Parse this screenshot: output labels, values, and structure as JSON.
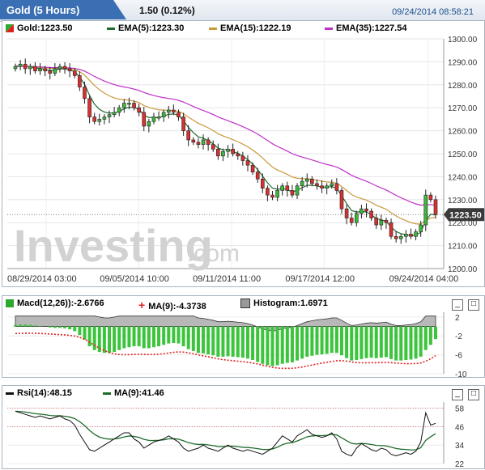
{
  "header": {
    "instrument_tab": "Gold (5 Hours)",
    "change": "1.50 (0.12%)",
    "datetime": "09/24/2014 08:58:21"
  },
  "price_panel": {
    "legend": [
      {
        "label": "Gold:1223.50",
        "color": "#ffffff"
      },
      {
        "label": "EMA(5):1223.30",
        "color": "#1f6b2c"
      },
      {
        "label": "EMA(15):1222.19",
        "color": "#c99a3a"
      },
      {
        "label": "EMA(35):1227.54",
        "color": "#c030c8"
      }
    ],
    "last_price_label": "1223.50",
    "watermark_main": "Investing",
    "watermark_suffix": ".com",
    "x_tick_labels": [
      "08/29/2014 03:00",
      "09/05/2014 10:00",
      "09/11/2014 11:00",
      "09/17/2014 12:00",
      "09/24/2014 04:00"
    ],
    "y_tick_labels": [
      "1300.00",
      "1290.00",
      "1280.00",
      "1270.00",
      "1260.00",
      "1250.00",
      "1240.00",
      "1230.00",
      "1220.00",
      "1210.00",
      "1200.00"
    ]
  },
  "macd_panel": {
    "legend": [
      {
        "label": "Macd(12,26)):-2.6766",
        "color": "#2ea82e"
      },
      {
        "label": "MA(9):-4.3738",
        "color": "#e02020"
      },
      {
        "label": "Histogram:1.6971",
        "color": "#9a9a9a"
      }
    ],
    "y_tick_labels": [
      "2",
      "-2",
      "-6",
      "-10"
    ],
    "minimize_icon": "minimize-icon",
    "maximize_icon": "maximize-icon"
  },
  "rsi_panel": {
    "legend": [
      {
        "label": "Rsi(14):48.15",
        "color": "#111111"
      },
      {
        "label": "MA(9):41.46",
        "color": "#1f6b2c"
      }
    ],
    "y_tick_labels": [
      "58",
      "46",
      "34",
      "22"
    ],
    "minimize_icon": "minimize-icon",
    "maximize_icon": "maximize-icon"
  },
  "chart_data": [
    {
      "type": "candlestick",
      "title": "Gold (5 Hours)",
      "ylim": [
        1200,
        1300
      ],
      "x_ticks": [
        "08/29/2014 03:00",
        "09/05/2014 10:00",
        "09/11/2014 11:00",
        "09/17/2014 12:00",
        "09/24/2014 04:00"
      ],
      "close": [
        1288,
        1289,
        1287,
        1288,
        1286,
        1287,
        1286,
        1285,
        1287,
        1288,
        1287,
        1286,
        1284,
        1279,
        1274,
        1266,
        1264,
        1265,
        1266,
        1267,
        1268,
        1270,
        1272,
        1272,
        1270,
        1268,
        1262,
        1264,
        1266,
        1266,
        1268,
        1269,
        1268,
        1266,
        1260,
        1256,
        1255,
        1254,
        1256,
        1254,
        1252,
        1249,
        1251,
        1252,
        1250,
        1249,
        1247,
        1245,
        1242,
        1239,
        1235,
        1232,
        1231,
        1234,
        1236,
        1234,
        1232,
        1236,
        1238,
        1239,
        1237,
        1236,
        1235,
        1236,
        1237,
        1234,
        1226,
        1222,
        1220,
        1224,
        1226,
        1225,
        1222,
        1219,
        1221,
        1220,
        1214,
        1213,
        1214,
        1215,
        1214,
        1216,
        1219,
        1232,
        1230,
        1223.5
      ],
      "series": [
        {
          "name": "EMA(5)",
          "last": 1223.3,
          "color": "#1f6b2c"
        },
        {
          "name": "EMA(15)",
          "last": 1222.19,
          "color": "#c99a3a"
        },
        {
          "name": "EMA(35)",
          "last": 1227.54,
          "color": "#c030c8"
        }
      ],
      "last_price": 1223.5
    },
    {
      "type": "bar",
      "title": "Macd(12,26)",
      "ylim": [
        -10,
        3
      ],
      "macd": [
        0.3,
        0.4,
        0.4,
        0.3,
        0.2,
        0.1,
        0.0,
        -0.2,
        -0.3,
        -0.3,
        -0.4,
        -0.6,
        -1.0,
        -1.8,
        -2.8,
        -4.2,
        -5.0,
        -5.4,
        -5.6,
        -5.6,
        -5.4,
        -5.0,
        -4.6,
        -4.4,
        -4.2,
        -4.2,
        -4.6,
        -4.6,
        -4.4,
        -4.2,
        -3.9,
        -3.6,
        -3.5,
        -3.6,
        -4.2,
        -4.8,
        -5.2,
        -5.6,
        -5.7,
        -5.9,
        -6.1,
        -6.4,
        -6.4,
        -6.3,
        -6.4,
        -6.5,
        -6.6,
        -6.8,
        -7.1,
        -7.5,
        -7.9,
        -8.2,
        -8.4,
        -8.2,
        -7.9,
        -7.7,
        -7.6,
        -7.2,
        -6.8,
        -6.4,
        -6.2,
        -6.0,
        -5.9,
        -5.8,
        -5.6,
        -5.6,
        -6.1,
        -6.7,
        -7.2,
        -7.1,
        -6.9,
        -6.7,
        -6.6,
        -6.7,
        -6.6,
        -6.5,
        -6.9,
        -7.2,
        -7.2,
        -7.1,
        -7.0,
        -6.8,
        -6.4,
        -5.0,
        -3.9,
        -2.6766
      ],
      "histogram": 1.6971,
      "signal_last": -4.3738
    },
    {
      "type": "line",
      "title": "Rsi(14)",
      "ylim": [
        22,
        62
      ],
      "rsi": [
        56,
        55,
        54,
        53,
        52,
        53,
        52,
        51,
        52,
        53,
        51,
        50,
        47,
        41,
        36,
        31,
        30,
        32,
        34,
        36,
        38,
        40,
        42,
        42,
        38,
        36,
        32,
        34,
        36,
        37,
        38,
        40,
        38,
        36,
        32,
        30,
        31,
        32,
        34,
        32,
        31,
        30,
        32,
        34,
        32,
        31,
        30,
        31,
        30,
        29,
        28,
        30,
        32,
        36,
        40,
        38,
        36,
        40,
        42,
        44,
        41,
        40,
        39,
        40,
        42,
        38,
        30,
        28,
        27,
        32,
        35,
        33,
        31,
        30,
        32,
        31,
        28,
        27,
        28,
        29,
        28,
        30,
        36,
        55,
        47,
        48.15
      ],
      "ma_last": 41.46,
      "ref_lines": [
        46,
        58
      ]
    }
  ]
}
